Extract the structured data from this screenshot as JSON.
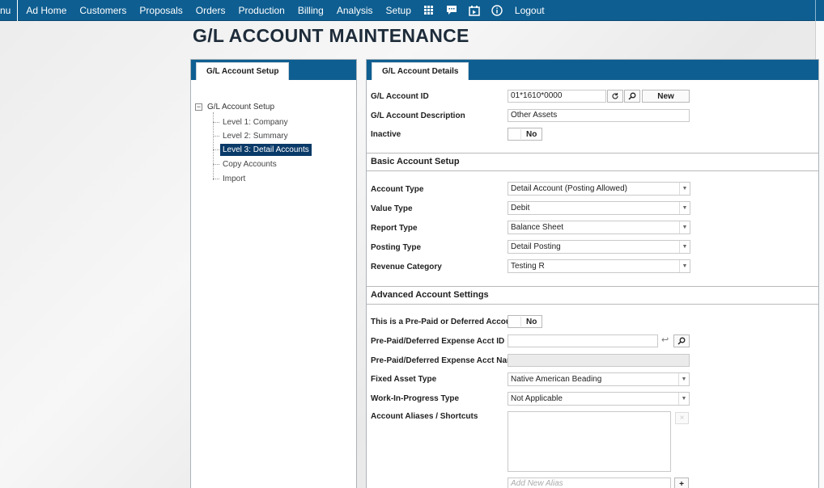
{
  "nav": {
    "menu_fragment": "nu",
    "items": [
      "Ad Home",
      "Customers",
      "Proposals",
      "Orders",
      "Production",
      "Billing",
      "Analysis",
      "Setup"
    ],
    "icons": [
      "grid-icon",
      "chat-icon",
      "calendar-icon",
      "info-icon"
    ],
    "logout": "Logout"
  },
  "page": {
    "title": "G/L ACCOUNT MAINTENANCE"
  },
  "left_panel": {
    "tab": "G/L Account Setup",
    "tree": {
      "root": "G/L Account Setup",
      "toggle": "−",
      "children": [
        "Level 1: Company",
        "Level 2: Summary",
        "Level 3: Detail Accounts",
        "Copy Accounts",
        "Import"
      ],
      "selected_index": 2
    }
  },
  "right_panel": {
    "tab": "G/L Account Details",
    "account_id": {
      "label": "G/L Account ID",
      "value": "01*1610*0000",
      "new_button": "New"
    },
    "description": {
      "label": "G/L Account Description",
      "value": "Other Assets"
    },
    "inactive": {
      "label": "Inactive",
      "value": "No"
    },
    "basic_section": {
      "title": "Basic Account Setup",
      "fields": [
        {
          "label": "Account Type",
          "value": "Detail Account (Posting Allowed)"
        },
        {
          "label": "Value Type",
          "value": "Debit"
        },
        {
          "label": "Report Type",
          "value": "Balance Sheet"
        },
        {
          "label": "Posting Type",
          "value": "Detail Posting"
        },
        {
          "label": "Revenue Category",
          "value": "Testing R"
        }
      ]
    },
    "advanced_section": {
      "title": "Advanced Account Settings",
      "prepaid": {
        "label": "This is a Pre-Paid or Deferred Account",
        "value": "No"
      },
      "expense_acct_id": {
        "label": "Pre-Paid/Deferred Expense Acct ID",
        "value": ""
      },
      "expense_acct_name": {
        "label": "Pre-Paid/Deferred Expense Acct Name",
        "value": ""
      },
      "fixed_asset": {
        "label": "Fixed Asset Type",
        "value": "Native American Beading"
      },
      "wip": {
        "label": "Work-In-Progress Type",
        "value": "Not Applicable"
      },
      "aliases": {
        "label": "Account Aliases / Shortcuts",
        "placeholder": "Add New Alias",
        "add": "+",
        "remove": "×"
      }
    }
  }
}
